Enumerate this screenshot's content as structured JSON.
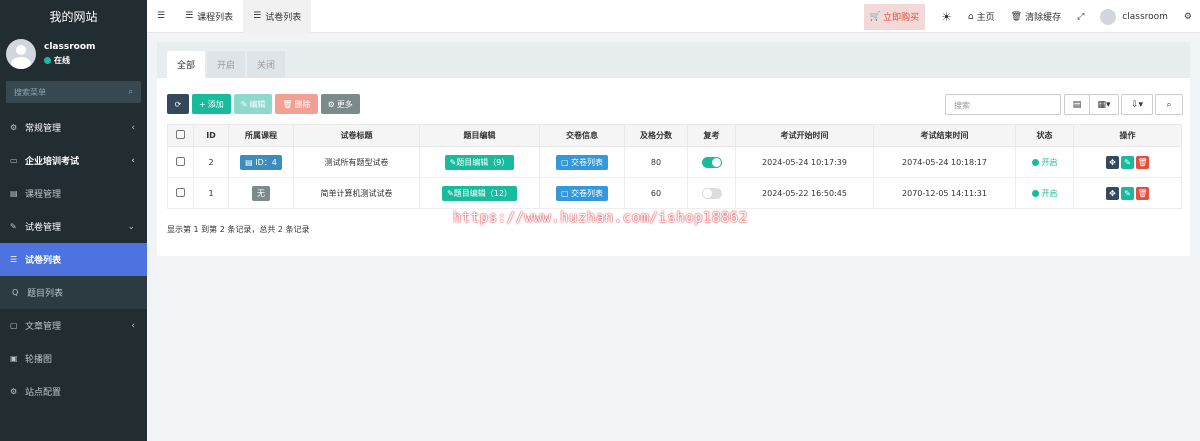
{
  "sidebar": {
    "site_title": "我的网站",
    "user_name": "classroom",
    "online": "在线",
    "search_placeholder": "搜索菜单",
    "items": [
      {
        "label": "常规管理"
      },
      {
        "label": "企业培训考试"
      },
      {
        "label": "课程管理"
      },
      {
        "label": "试卷管理"
      },
      {
        "label": "试卷列表"
      },
      {
        "label": "题目列表"
      },
      {
        "label": "文章管理"
      },
      {
        "label": "轮播图"
      },
      {
        "label": "站点配置"
      }
    ]
  },
  "navbar": {
    "tabs": [
      {
        "label": "课程列表"
      },
      {
        "label": "试卷列表"
      }
    ],
    "buy": "立即购买",
    "home": "主页",
    "clear_cache": "清除缓存",
    "user": "classroom"
  },
  "panel": {
    "tabs": [
      {
        "label": "全部"
      },
      {
        "label": "开启"
      },
      {
        "label": "关闭"
      }
    ],
    "toolbar": {
      "add": "添加",
      "edit": "编辑",
      "delete": "删除",
      "more": "更多"
    },
    "search_placeholder": "搜索"
  },
  "table": {
    "headers": [
      "ID",
      "所属课程",
      "试卷标题",
      "题目编辑",
      "交卷信息",
      "及格分数",
      "复考",
      "考试开始时间",
      "考试结束时间",
      "状态",
      "操作"
    ],
    "rows": [
      {
        "id": "2",
        "course": "ID：4",
        "title": "测试所有题型试卷",
        "edit": "题目编辑（9）",
        "submit": "交卷列表",
        "pass": "80",
        "retake": true,
        "start": "2024-05-24 10:17:39",
        "end": "2074-05-24 10:18:17",
        "status": "开启"
      },
      {
        "id": "1",
        "course": "无",
        "title": "简单计算机测试试卷",
        "edit": "题目编辑（12）",
        "submit": "交卷列表",
        "pass": "60",
        "retake": false,
        "start": "2024-05-22 16:50:45",
        "end": "2070-12-05 14:11:31",
        "status": "开启"
      }
    ]
  },
  "summary": "显示第 1 到第 2 条记录，总共 2 条记录",
  "watermark": "https://www.huzhan.com/ishop18862"
}
